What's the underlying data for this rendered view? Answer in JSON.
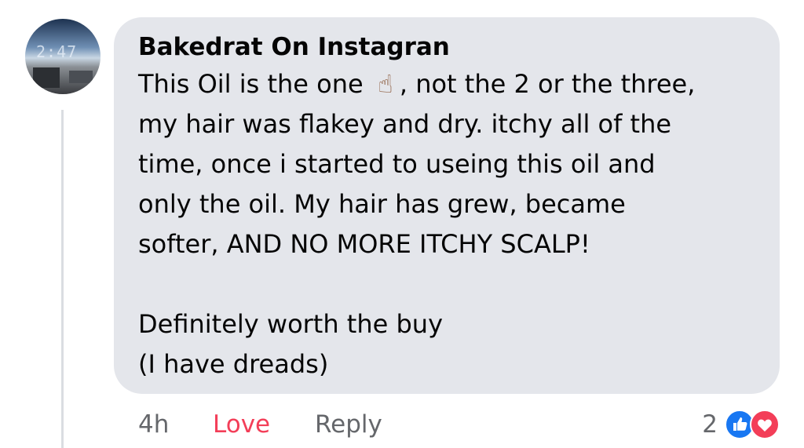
{
  "comment": {
    "avatar": {
      "clock_text": "2:47",
      "icon": "profile-photo"
    },
    "author": "Bakedrat On Instagran",
    "lines": [
      {
        "before": "This Oil is the one ",
        "emoji": "☝",
        "after": ", not the 2 or the three,"
      },
      {
        "text": "my hair was flakey and dry. itchy all of the"
      },
      {
        "text": "time, once i started to useing this oil and"
      },
      {
        "text": "only the oil. My hair has grew, became"
      },
      {
        "text": "softer, AND NO MORE ITCHY SCALP!"
      },
      {
        "text": ""
      },
      {
        "text": "Definitely worth the buy"
      },
      {
        "text": "(I have dreads)"
      }
    ],
    "emoji_icon": "index-pointing-up-icon",
    "emoji_color": "#8b5a3c",
    "bubble_color": "#e4e6eb"
  },
  "actions": {
    "time": "4h",
    "love": "Love",
    "reply": "Reply",
    "love_color": "#f33e58"
  },
  "reactions": {
    "count": "2",
    "icons": [
      "like-icon",
      "love-icon"
    ],
    "like_color": "#1877f2",
    "love_color": "#f33e58"
  }
}
